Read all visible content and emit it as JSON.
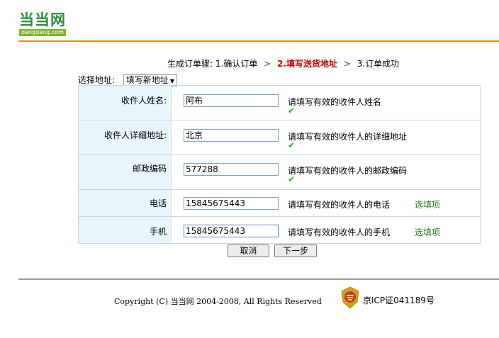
{
  "logo": {
    "cn": "当当网",
    "en": "dangdang.com"
  },
  "steps": {
    "prefix": "生成订单骤:",
    "step1": "1.确认订单",
    "step2": "2.填写送货地址",
    "step3": "3.订单成功",
    "separator": ">"
  },
  "address_select": {
    "label": "选择地址:",
    "value": "填写新地址"
  },
  "form": {
    "rows": [
      {
        "label": "收件人姓名:",
        "value": "阿布",
        "hint": "请填写有效的收件人姓名",
        "valid": true,
        "optional": ""
      },
      {
        "label": "收件人详细地址:",
        "value": "北京",
        "hint": "请填写有效的收件人的详细地址",
        "valid": true,
        "optional": ""
      },
      {
        "label": "邮政编码",
        "value": "577288",
        "hint": "请填写有效的收件人的邮政编码",
        "valid": true,
        "optional": ""
      },
      {
        "label": "电话",
        "value": "15845675443",
        "hint": "请填写有效的收件人的电话",
        "valid": false,
        "optional": "选填项"
      },
      {
        "label": "手机",
        "value": "15845675443",
        "hint": "请填写有效的收件人的手机",
        "valid": false,
        "optional": "选填项"
      }
    ],
    "check_icon": "check-icon"
  },
  "buttons": {
    "cancel": "取消",
    "next": "下一步"
  },
  "footer": {
    "copyright": "Copyright (C) 当当网 2004-2008, All Rights Reserved",
    "icp": "京ICP证041189号"
  },
  "colors": {
    "accent_line": "#f08a24",
    "current_step": "#cc0000",
    "label_bg": "#e8f5fb",
    "optional": "#2a7a1e",
    "check": "#2ea82e"
  }
}
